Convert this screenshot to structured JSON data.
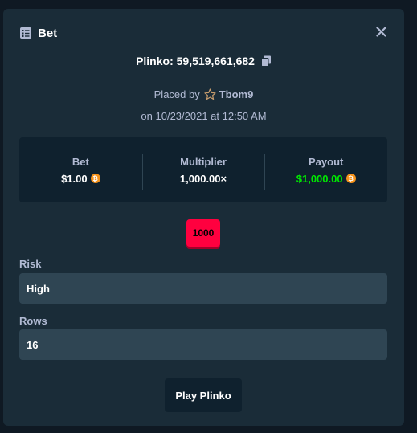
{
  "modal": {
    "title": "Bet",
    "header_icon": "bet-slip-icon",
    "close_icon": "close-icon"
  },
  "game": {
    "id_label": "Plinko: 59,519,661,682",
    "copy_icon": "copy-icon"
  },
  "placed": {
    "prefix": "Placed by",
    "star_icon": "star-icon",
    "username": "Tbom9",
    "date": "on 10/23/2021 at 12:50 AM"
  },
  "stats": {
    "bet_label": "Bet",
    "bet_value": "$1.00",
    "multiplier_label": "Multiplier",
    "multiplier_value": "1,000.00×",
    "payout_label": "Payout",
    "payout_value": "$1,000.00",
    "coin_icon": "bitcoin-icon",
    "coin_glyph": "₿",
    "payout_color": "#00e701"
  },
  "result": {
    "multiplier_badge": "1000",
    "badge_color": "#ff003f"
  },
  "fields": {
    "risk_label": "Risk",
    "risk_value": "High",
    "rows_label": "Rows",
    "rows_value": "16"
  },
  "actions": {
    "play_label": "Play Plinko"
  }
}
